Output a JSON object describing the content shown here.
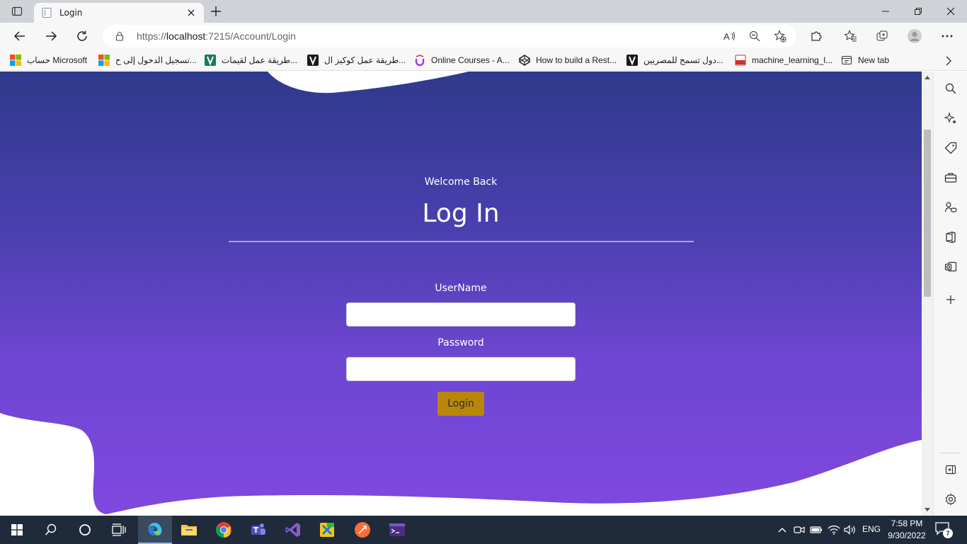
{
  "browser": {
    "tab": {
      "title": "Login"
    },
    "address_bar": {
      "url_scheme": "https://",
      "url_host": "localhost",
      "url_rest": ":7215/Account/Login"
    }
  },
  "favorites": [
    {
      "label": "حساب Microsoft",
      "icon": "microsoft-icon"
    },
    {
      "label": "تسجيل الدخول إلى ح...",
      "icon": "microsoft-icon"
    },
    {
      "label": "طريقة عمل لقيمات...",
      "icon": "recipe-site-icon"
    },
    {
      "label": "طريقة عمل كوكيز ال...",
      "icon": "recipe-site-icon"
    },
    {
      "label": "Online Courses - A...",
      "icon": "udemy-icon"
    },
    {
      "label": "How to build a Rest...",
      "icon": "codepen-icon"
    },
    {
      "label": "دول تسمح للمصريين...",
      "icon": "recipe-site-icon"
    },
    {
      "label": "machine_learning_l...",
      "icon": "pdf-icon"
    },
    {
      "label": "New tab",
      "icon": "new-tab-icon"
    }
  ],
  "page": {
    "welcome_text": "Welcome Back",
    "heading": "Log In",
    "username_label": "UserName",
    "username_value": "",
    "password_label": "Password",
    "password_value": "",
    "submit_label": "Login"
  },
  "taskbar": {
    "language": "ENG",
    "time": "7:58 PM",
    "date": "9/30/2022",
    "notification_count": "7"
  },
  "colors": {
    "gradient_top": "#2f3a8c",
    "gradient_bottom": "#8048de",
    "login_button": "#b8860b",
    "taskbar": "#1f2b3a"
  }
}
